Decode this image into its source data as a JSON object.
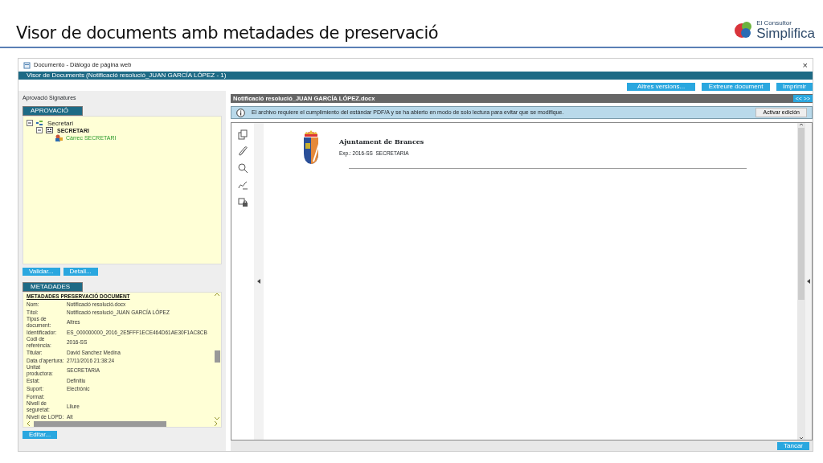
{
  "slide": {
    "title": "Visor de documents amb metadades de preservació",
    "logo": {
      "small": "El Consultor",
      "large": "Simplifica"
    }
  },
  "window": {
    "title": "Documento - Diálogo de página web",
    "close": "×",
    "header": "Visor de Documents (Notificació resolució_JUAN GARCÍA LÓPEZ - 1)"
  },
  "left": {
    "section_label": "Aprovació Signatures",
    "approval_tab": "APROVACIÓ",
    "tree": [
      {
        "label": "Secretari",
        "kind": "group",
        "expanded": true,
        "children": [
          {
            "label": "SECRETARI",
            "kind": "unit",
            "expanded": true,
            "children": [
              {
                "label": "Càrrec SECRETARI",
                "kind": "position"
              }
            ]
          }
        ]
      }
    ],
    "approval_buttons": [
      "Validar...",
      "Detall..."
    ],
    "metadata_tab": "METADADES",
    "metadata": {
      "heading": "METADADES PRESERVACIÓ DOCUMENT",
      "rows": [
        {
          "label": "Nom:",
          "value": "Notificació resolució.docx"
        },
        {
          "label": "Títol:",
          "value": "Notificació resolució_JUAN GARCÍA LÓPEZ"
        },
        {
          "label": "Tipus de document:",
          "value": "Altres"
        },
        {
          "label": "Identificador:",
          "value": "ES_000000000_2016_2E5FFF1ECE464D61AE30F1AC8CB"
        },
        {
          "label": "Codi de referència:",
          "value": "2016-SS"
        },
        {
          "label": "Titular:",
          "value": "David Sanchez Medina"
        },
        {
          "label": "Data d'apertura:",
          "value": "27/11/2016 21:38:24"
        },
        {
          "label": "Unitat productora:",
          "value": "SECRETARIA"
        },
        {
          "label": "Estat:",
          "value": "Definitiu"
        },
        {
          "label": "Suport:",
          "value": "Electrònic"
        },
        {
          "label": "Format:",
          "value": ""
        },
        {
          "label": "Nivell de seguretat:",
          "value": "Lliure"
        },
        {
          "label": "Nivell de LOPD:",
          "value": "Alt"
        }
      ]
    },
    "edit_button": "Editar..."
  },
  "viewer": {
    "toolbar_buttons": [
      "Altres versions...",
      "Extreure document",
      "Imprimir"
    ],
    "file_name": "Notificació resolució_JUAN GARCÍA LÓPEZ.docx",
    "pager": "<< >>",
    "notice": "El archivo requiere el cumplimiento del estándar PDF/A y se ha abierto en modo de solo lectura para evitar que se modifique.",
    "notice_button": "Activar edición",
    "document": {
      "heading": "Ajuntament de Brances",
      "subtitle": "Exp.: 2016-SS  SECRETARIA"
    },
    "close_button": "Tancar"
  }
}
